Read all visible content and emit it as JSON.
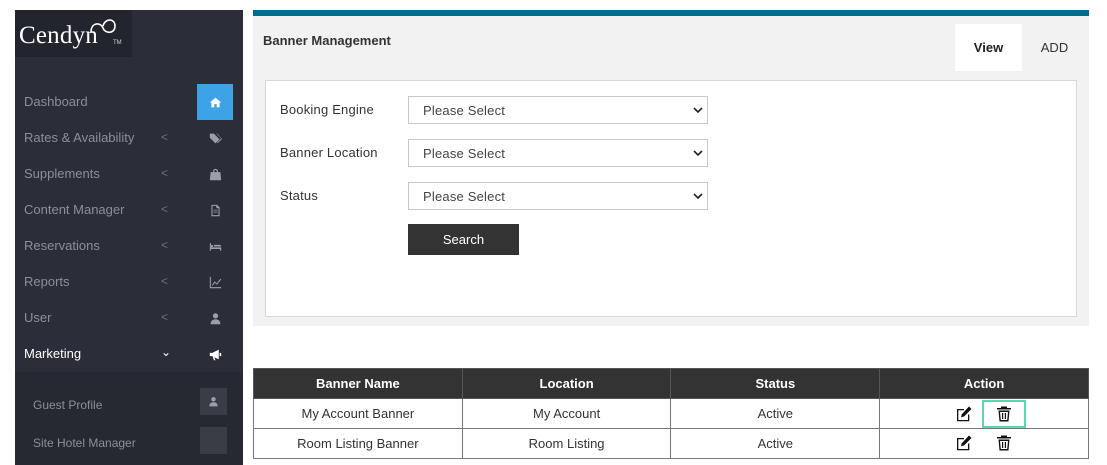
{
  "app": {
    "logo_text": "Cendyn",
    "logo_tm": "TM"
  },
  "sidebar": {
    "items": [
      {
        "label": "Dashboard",
        "icon": "home-icon",
        "active": true
      },
      {
        "label": "Rates & Availability",
        "icon": "tag-icon"
      },
      {
        "label": "Supplements",
        "icon": "bag-icon"
      },
      {
        "label": "Content Manager",
        "icon": "document-icon"
      },
      {
        "label": "Reservations",
        "icon": "bed-icon"
      },
      {
        "label": "Reports",
        "icon": "chart-icon"
      },
      {
        "label": "User",
        "icon": "user-icon"
      },
      {
        "label": "Marketing",
        "icon": "megaphone-icon",
        "expanded": true
      }
    ],
    "submenu": [
      {
        "label": "Guest Profile",
        "icon": "user-icon"
      },
      {
        "label": "Site Hotel Manager",
        "icon": "blank-icon"
      }
    ]
  },
  "page": {
    "title": "Banner Management",
    "tabs": {
      "view": "View",
      "add": "ADD"
    }
  },
  "filters": {
    "booking_engine": {
      "label": "Booking Engine",
      "value": "Please Select"
    },
    "banner_location": {
      "label": "Banner Location",
      "value": "Please Select"
    },
    "status": {
      "label": "Status",
      "value": "Please Select"
    },
    "search_label": "Search"
  },
  "table": {
    "headers": [
      "Banner Name",
      "Location",
      "Status",
      "Action"
    ],
    "rows": [
      {
        "name": "My Account Banner",
        "location": "My Account",
        "status": "Active"
      },
      {
        "name": "Room Listing Banner",
        "location": "Room Listing",
        "status": "Active"
      }
    ]
  },
  "colors": {
    "accent": "#3ea2e6",
    "topbar": "#006a96",
    "sidebar": "#2b2e38",
    "focus": "#5cd6b0"
  }
}
